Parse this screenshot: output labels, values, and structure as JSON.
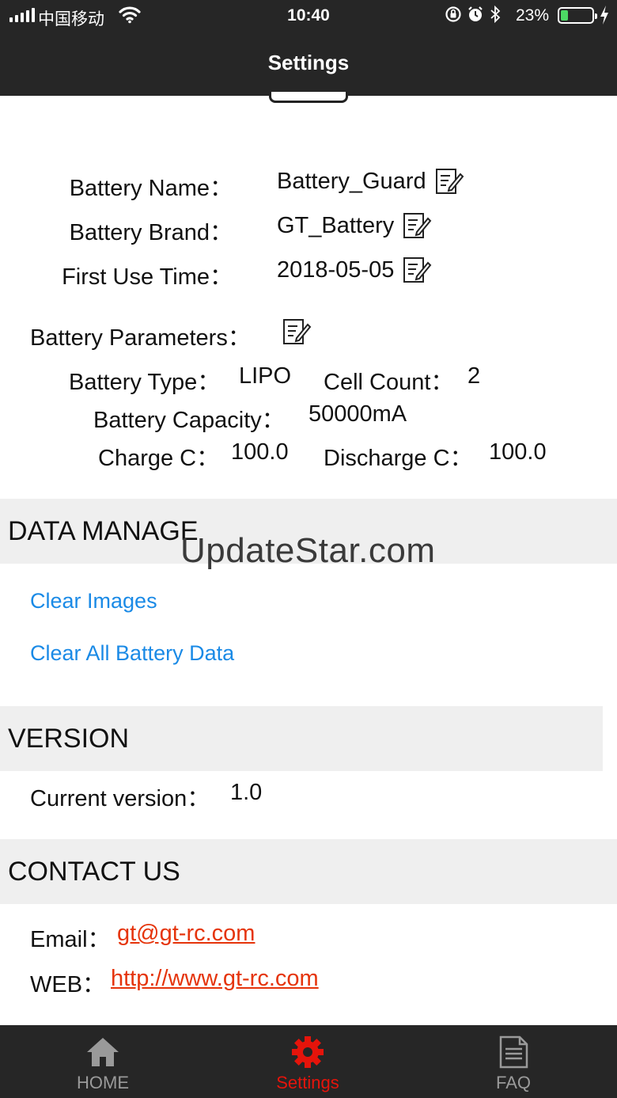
{
  "status_bar": {
    "carrier": "中国移动",
    "time": "10:40",
    "battery_percent": "23%",
    "battery_level": 0.23,
    "icons": [
      "signal-icon",
      "wifi-icon",
      "orientation-lock-icon",
      "alarm-icon",
      "bluetooth-icon",
      "battery-icon",
      "charging-icon"
    ]
  },
  "nav": {
    "title": "Settings"
  },
  "battery_info": {
    "name_label": "Battery Name：",
    "name_value": "Battery_Guard",
    "brand_label": "Battery Brand：",
    "brand_value": "GT_Battery",
    "first_use_label": "First Use Time：",
    "first_use_value": "2018-05-05",
    "params_label": "Battery Parameters："
  },
  "parameters": {
    "type_label": "Battery Type：",
    "type_value": "LIPO",
    "cell_count_label": "Cell Count：",
    "cell_count_value": "2",
    "capacity_label": "Battery Capacity：",
    "capacity_value": "50000mA",
    "charge_label": "Charge C：",
    "charge_value": "100.0",
    "discharge_label": "Discharge C：",
    "discharge_value": "100.0"
  },
  "data_manage": {
    "title": "DATA MANAGE",
    "clear_images": "Clear Images",
    "clear_all": "Clear All Battery Data"
  },
  "watermark": "UpdateStar.com",
  "version": {
    "title": "VERSION",
    "current_label": "Current version：",
    "current_value": "1.0"
  },
  "contact": {
    "title": "CONTACT US",
    "email_label": "Email：",
    "email_value": "gt@gt-rc.com",
    "web_label": "WEB：",
    "web_value": "http://www.gt-rc.com"
  },
  "tabbar": {
    "home": "HOME",
    "settings": "Settings",
    "faq": "FAQ",
    "active_color": "#e5140b",
    "inactive_color": "#9a9a9a"
  }
}
